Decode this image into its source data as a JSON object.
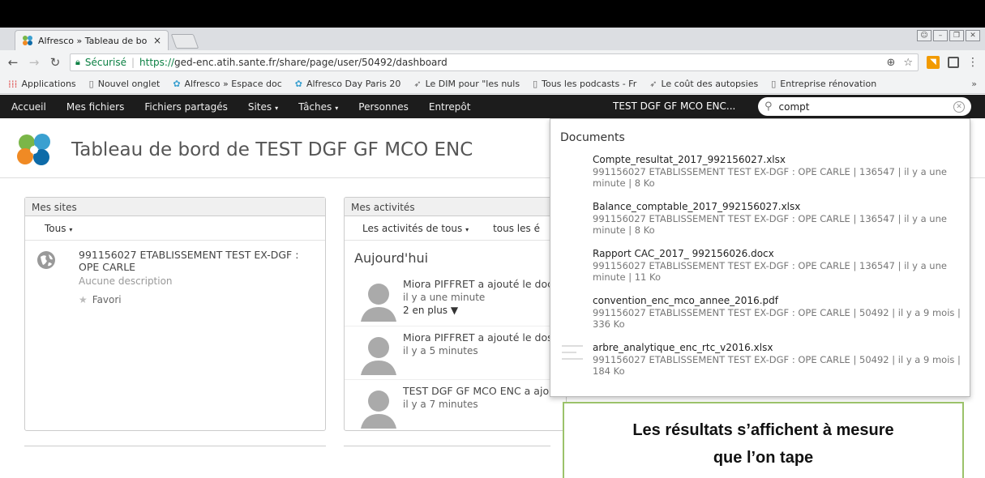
{
  "browser": {
    "tab_title": "Alfresco » Tableau de bo",
    "tab_close": "×",
    "secure_label": "Sécurisé",
    "url_scheme": "https://",
    "url_rest": "ged-enc.atih.sante.fr/share/page/user/50492/dashboard",
    "bookmarks": [
      {
        "label": "Applications",
        "icon": "apps-grid-icon"
      },
      {
        "label": "Nouvel onglet",
        "icon": "page-icon"
      },
      {
        "label": "Alfresco » Espace doc",
        "icon": "alfresco-leaf-icon"
      },
      {
        "label": "Alfresco Day Paris 20",
        "icon": "alfresco-leaf-icon"
      },
      {
        "label": "Le DIM pour \"les nuls",
        "icon": "bird-icon"
      },
      {
        "label": "Tous les podcasts - Fr",
        "icon": "page-icon"
      },
      {
        "label": "Le coût des autopsies",
        "icon": "bird-icon"
      },
      {
        "label": "Entreprise rénovation",
        "icon": "page-icon"
      }
    ],
    "bookmarks_more": "»"
  },
  "appnav": {
    "items": [
      {
        "label": "Accueil",
        "caret": ""
      },
      {
        "label": "Mes fichiers",
        "caret": ""
      },
      {
        "label": "Fichiers partagés",
        "caret": ""
      },
      {
        "label": "Sites",
        "caret": "▾"
      },
      {
        "label": "Tâches",
        "caret": "▾"
      },
      {
        "label": "Personnes",
        "caret": ""
      },
      {
        "label": "Entrepôt",
        "caret": ""
      }
    ],
    "site_name": "TEST DGF GF MCO ENC...",
    "search_value": "compt"
  },
  "page": {
    "title": "Tableau de bord de TEST DGF GF MCO ENC"
  },
  "sites_dashlet": {
    "header": "Mes sites",
    "filter": "Tous",
    "filter_caret": "▾",
    "site": {
      "name": "991156027 ETABLISSEMENT TEST EX-DGF : OPE CARLE",
      "description": "Aucune description",
      "favorite": "Favori"
    }
  },
  "activities_dashlet": {
    "header": "Mes activités",
    "filter1": "Les activités de tous",
    "filter1_caret": "▾",
    "filter2": "tous les é",
    "today": "Aujourd'hui",
    "items": [
      {
        "text": "Miora PIFFRET a ajouté le doc",
        "time": "il y a une minute",
        "more": "2 en plus ▼"
      },
      {
        "text": "Miora PIFFRET a ajouté le dos",
        "time": "il y a 5 minutes",
        "more": ""
      },
      {
        "text": "TEST DGF GF MCO ENC a ajouté",
        "time": "il y a 7 minutes",
        "more": ""
      }
    ]
  },
  "search_results": {
    "heading": "Documents",
    "items": [
      {
        "name": "Compte_resultat_2017_992156027.xlsx",
        "meta": "991156027 ETABLISSEMENT TEST EX-DGF : OPE CARLE | 136547 | il y a une minute | 8 Ko",
        "icon": "none"
      },
      {
        "name": "Balance_comptable_2017_992156027.xlsx",
        "meta": "991156027 ETABLISSEMENT TEST EX-DGF : OPE CARLE | 136547 | il y a une minute | 8 Ko",
        "icon": "none"
      },
      {
        "name": "Rapport CAC_2017_ 992156026.docx",
        "meta": "991156027 ETABLISSEMENT TEST EX-DGF : OPE CARLE | 136547 | il y a une minute | 11 Ko",
        "icon": "none"
      },
      {
        "name": "convention_enc_mco_annee_2016.pdf",
        "meta": "991156027 ETABLISSEMENT TEST EX-DGF : OPE CARLE | 50492 | il y a 9 mois | 336 Ko",
        "icon": "none"
      },
      {
        "name": "arbre_analytique_enc_rtc_v2016.xlsx",
        "meta": "991156027 ETABLISSEMENT TEST EX-DGF : OPE CARLE | 50492 | il y a 9 mois | 184 Ko",
        "icon": "document-lines-icon"
      }
    ]
  },
  "callout": {
    "line1": "Les résultats s’affichent à mesure",
    "line2": "que l’on tape"
  }
}
